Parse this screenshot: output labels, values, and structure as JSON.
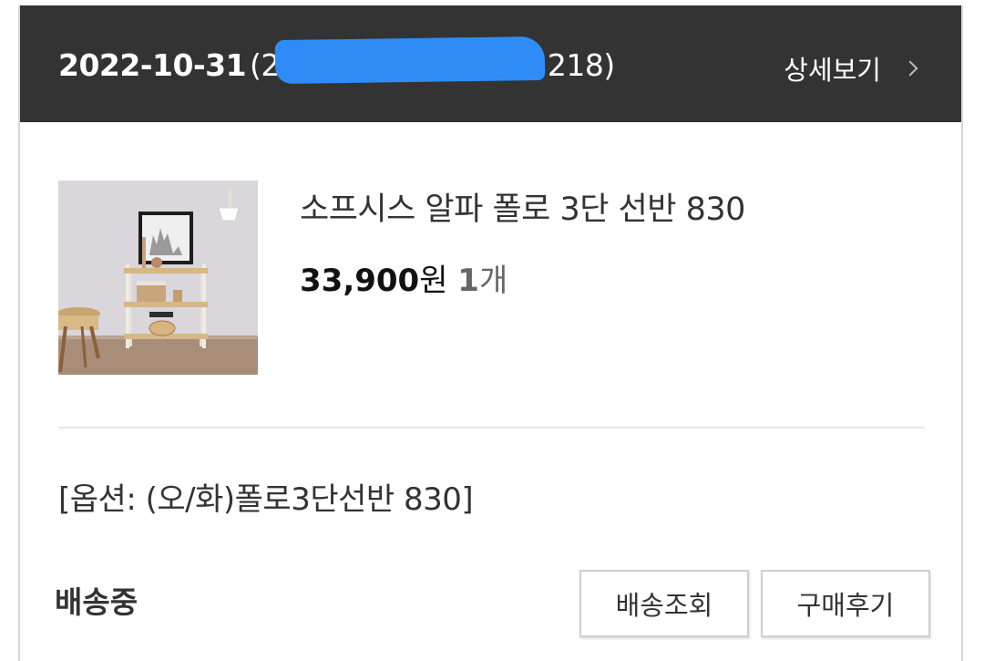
{
  "order": {
    "date": "2022-10-31",
    "number_open": "(2",
    "number_close": "218)",
    "detail_label": "상세보기"
  },
  "product": {
    "name": "소프시스 알파 폴로 3단 선반 830",
    "price": "33,900",
    "price_unit": "원",
    "quantity": "1",
    "quantity_unit": "개",
    "option": "[옵션: (오/화)폴로3단선반 830]"
  },
  "shipping": {
    "status": "배송중",
    "track_label": "배송조회",
    "review_label": "구매후기"
  },
  "colors": {
    "header_bg": "#333333",
    "redaction": "#2f8cf6"
  },
  "icons": {
    "detail": "chevron-right-icon"
  }
}
